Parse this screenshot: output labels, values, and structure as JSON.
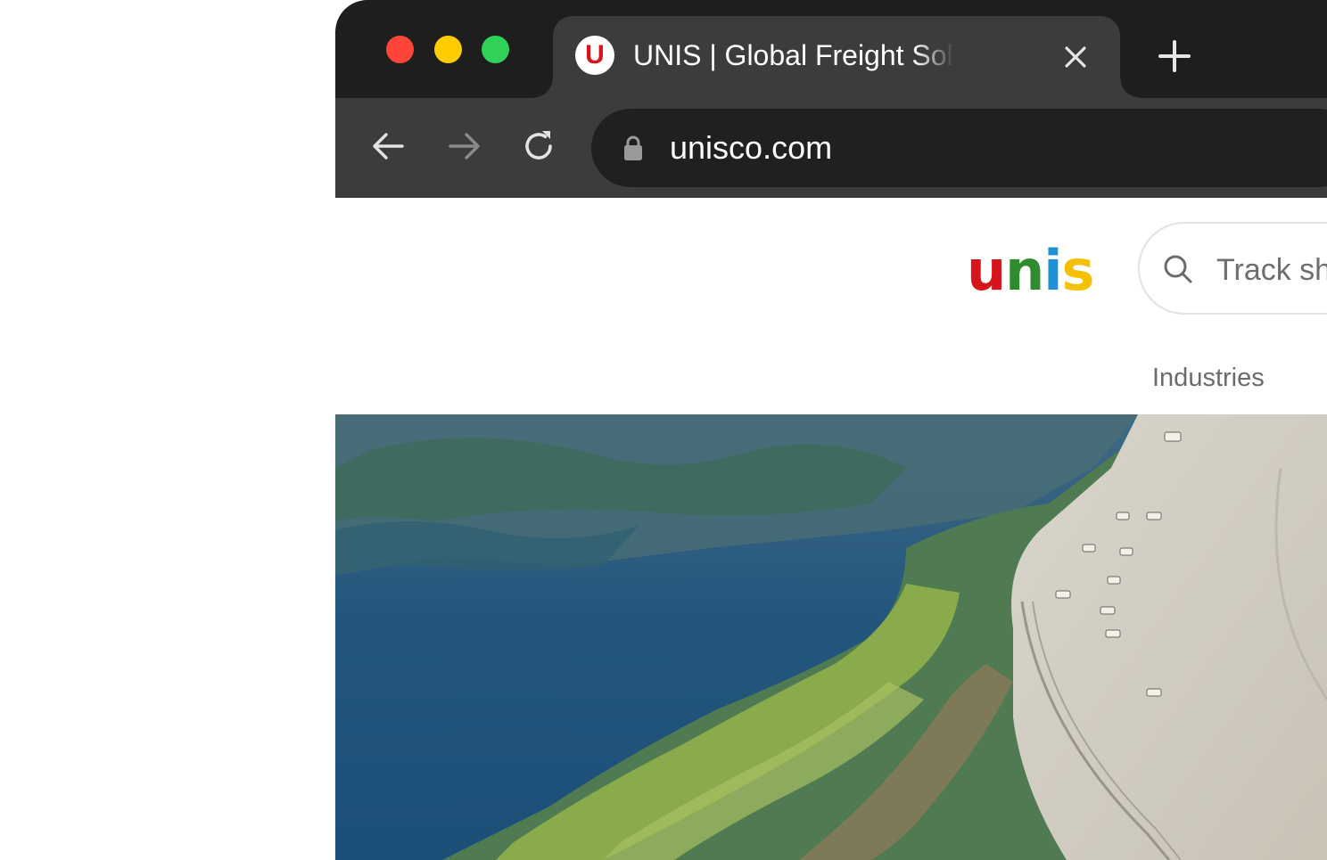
{
  "browser": {
    "tab": {
      "title": "UNIS | Global Freight Solutions",
      "favicon_letter": "U",
      "favicon_color": "#d7141c"
    },
    "address_bar": {
      "url": "unisco.com"
    },
    "icons": [
      "close-icon",
      "plus-icon",
      "back-arrow-icon",
      "forward-arrow-icon",
      "reload-icon",
      "lock-icon"
    ]
  },
  "site": {
    "logo": {
      "letters": [
        "u",
        "n",
        "i",
        "s"
      ],
      "colors": [
        "#d7141c",
        "#2e8b2e",
        "#1f8fd6",
        "#f5c000"
      ]
    },
    "search": {
      "placeholder": "Track shipment"
    },
    "nav": {
      "industries": "Industries"
    },
    "hero": {
      "description_icon": "aerial-coastline-image"
    }
  }
}
